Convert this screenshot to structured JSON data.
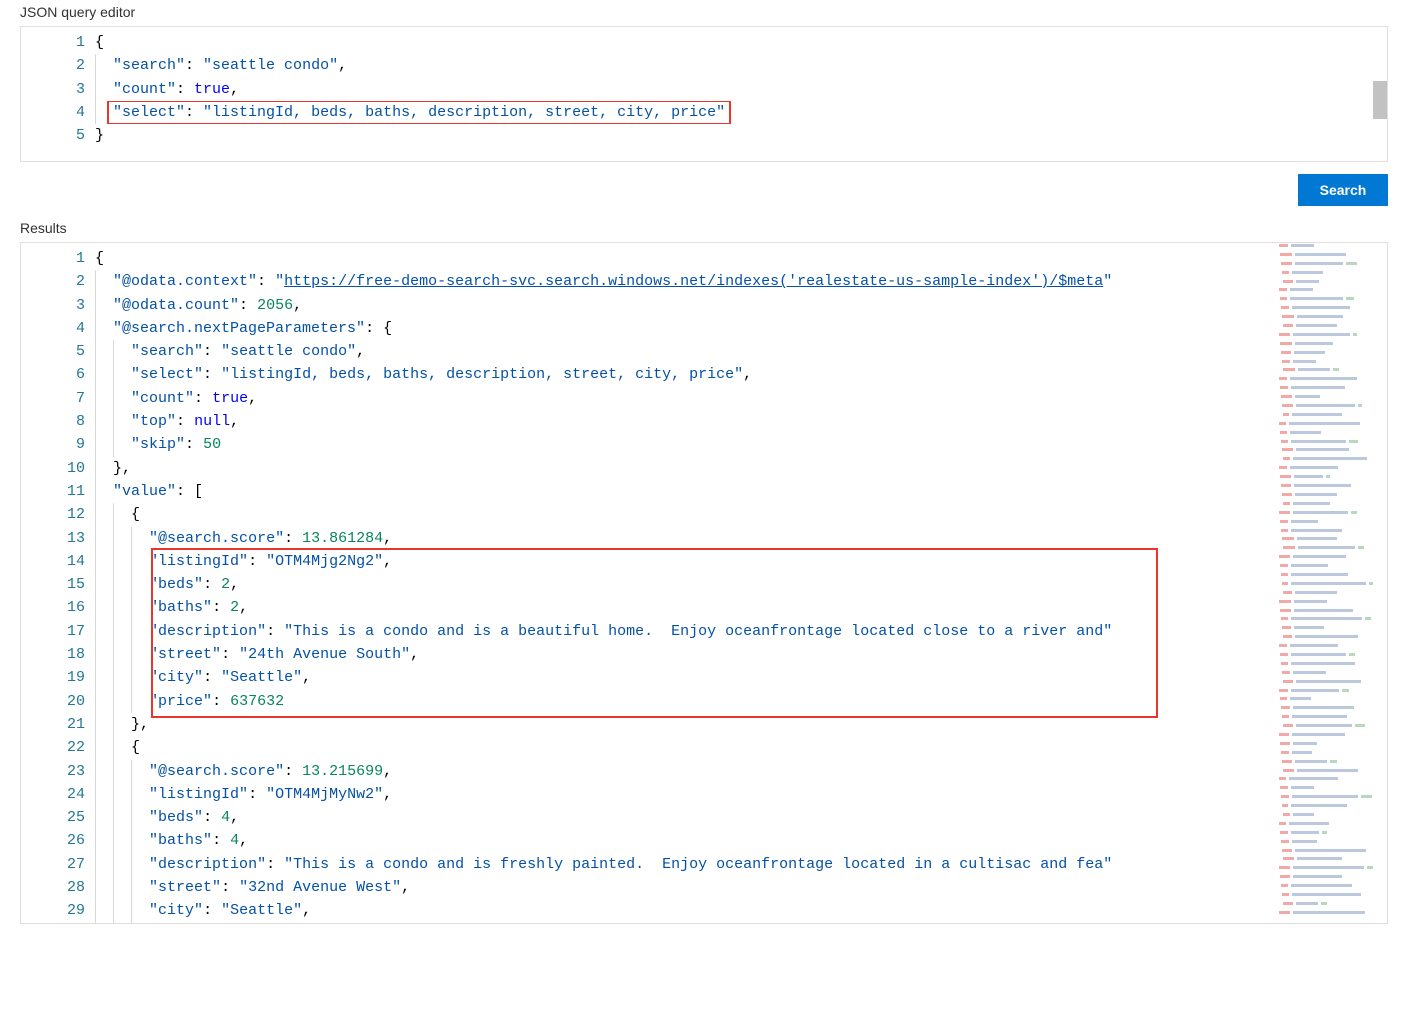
{
  "labels": {
    "queryEditor": "JSON query editor",
    "results": "Results",
    "searchButton": "Search"
  },
  "query": {
    "search": "seattle condo",
    "count": true,
    "select": "listingId, beds, baths, description, street, city, price"
  },
  "results": {
    "@odata.context": "https://free-demo-search-svc.search.windows.net/indexes('realestate-us-sample-index')/$meta",
    "@odata.count": 2056,
    "@search.nextPageParameters": {
      "search": "seattle condo",
      "select": "listingId, beds, baths, description, street, city, price",
      "count": true,
      "top": null,
      "skip": 50
    },
    "value": [
      {
        "@search.score": 13.861284,
        "listingId": "OTM4Mjg2Ng2",
        "beds": 2,
        "baths": 2,
        "description": "This is a condo and is a beautiful home.  Enjoy oceanfrontage located close to a river and",
        "street": "24th Avenue South",
        "city": "Seattle",
        "price": 637632
      },
      {
        "@search.score": 13.215699,
        "listingId": "OTM4MjMyNw2",
        "beds": 4,
        "baths": 4,
        "description": "This is a condo and is freshly painted.  Enjoy oceanfrontage located in a cultisac and fea",
        "street": "32nd Avenue West",
        "city": "Seattle"
      }
    ]
  },
  "resultsLineCount": 29
}
